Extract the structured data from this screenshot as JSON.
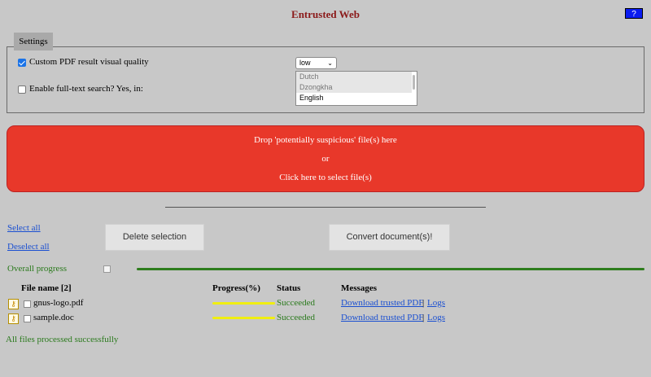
{
  "app": {
    "title": "Entrusted Web",
    "help_label": "?"
  },
  "settings": {
    "legend": "Settings",
    "custom_quality": {
      "label": "Custom PDF result visual quality",
      "checked": true,
      "selected": "low",
      "chevron": "⌄"
    },
    "fulltext": {
      "label": "Enable full-text search? Yes, in:",
      "checked": false,
      "languages": [
        "Dutch",
        "Dzongkha",
        "English"
      ],
      "selected_language": "English"
    }
  },
  "dropzone": {
    "line1": "Drop 'potentially suspicious' file(s) here",
    "line2": "or",
    "line3": "Click here to select file(s)"
  },
  "actions": {
    "select_all": "Select all",
    "deselect_all": "Deselect all",
    "delete_selection": "Delete selection",
    "convert": "Convert document(s)!"
  },
  "progress": {
    "label": "Overall progress",
    "value": 100
  },
  "table": {
    "headers": {
      "file_name": "File name [2]",
      "progress": "Progress(%)",
      "status": "Status",
      "messages": "Messages"
    },
    "rows": [
      {
        "icon": "key-icon",
        "file_name": "gnus-logo.pdf",
        "progress": 100,
        "status": "Succeeded",
        "download_link": "Download trusted PDF",
        "separator": "|",
        "logs_link": "Logs"
      },
      {
        "icon": "key-icon",
        "file_name": "sample.doc",
        "progress": 100,
        "status": "Succeeded",
        "download_link": "Download trusted PDF",
        "separator": "|",
        "logs_link": "Logs"
      }
    ]
  },
  "footer": {
    "message": "All files processed successfully"
  },
  "colors": {
    "background": "#c8c8c8",
    "title": "#8b1a1a",
    "dropzone": "#e8382a",
    "success": "#2a7a1c",
    "progress_bar": "#f0ee10",
    "link": "#1a4fd1"
  }
}
